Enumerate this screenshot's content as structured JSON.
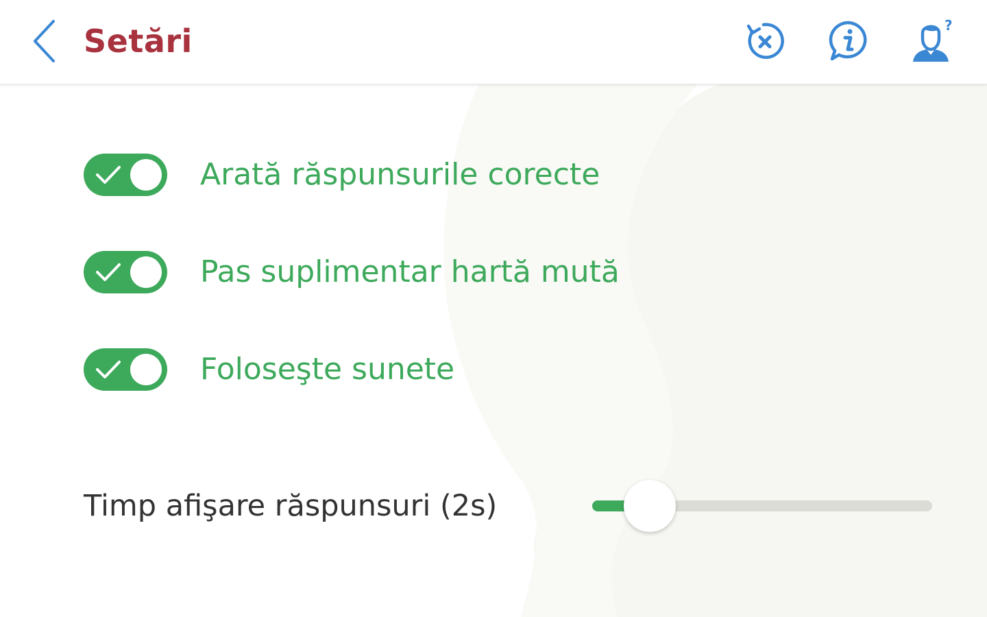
{
  "header": {
    "title": "Setări",
    "back_icon": "chevron-left-icon",
    "actions": [
      {
        "name": "reset-answers-button",
        "icon": "reset-x-icon"
      },
      {
        "name": "info-button",
        "icon": "info-icon"
      },
      {
        "name": "help-button",
        "icon": "user-question-icon"
      }
    ]
  },
  "settings": {
    "toggles": [
      {
        "label": "Arată răspunsurile corecte",
        "checked": true
      },
      {
        "label": "Pas suplimentar hartă mută",
        "checked": true
      },
      {
        "label": "Foloseşte sunete",
        "checked": true
      }
    ],
    "slider": {
      "label": "Timp afişare răspunsuri (2s)",
      "value_fraction": 0.17
    }
  },
  "colors": {
    "accent_green": "#3da95b",
    "title_red": "#a8323e",
    "icon_blue": "#3a87d4",
    "text_dark": "#333333",
    "track_gray": "#dcdcd6"
  }
}
